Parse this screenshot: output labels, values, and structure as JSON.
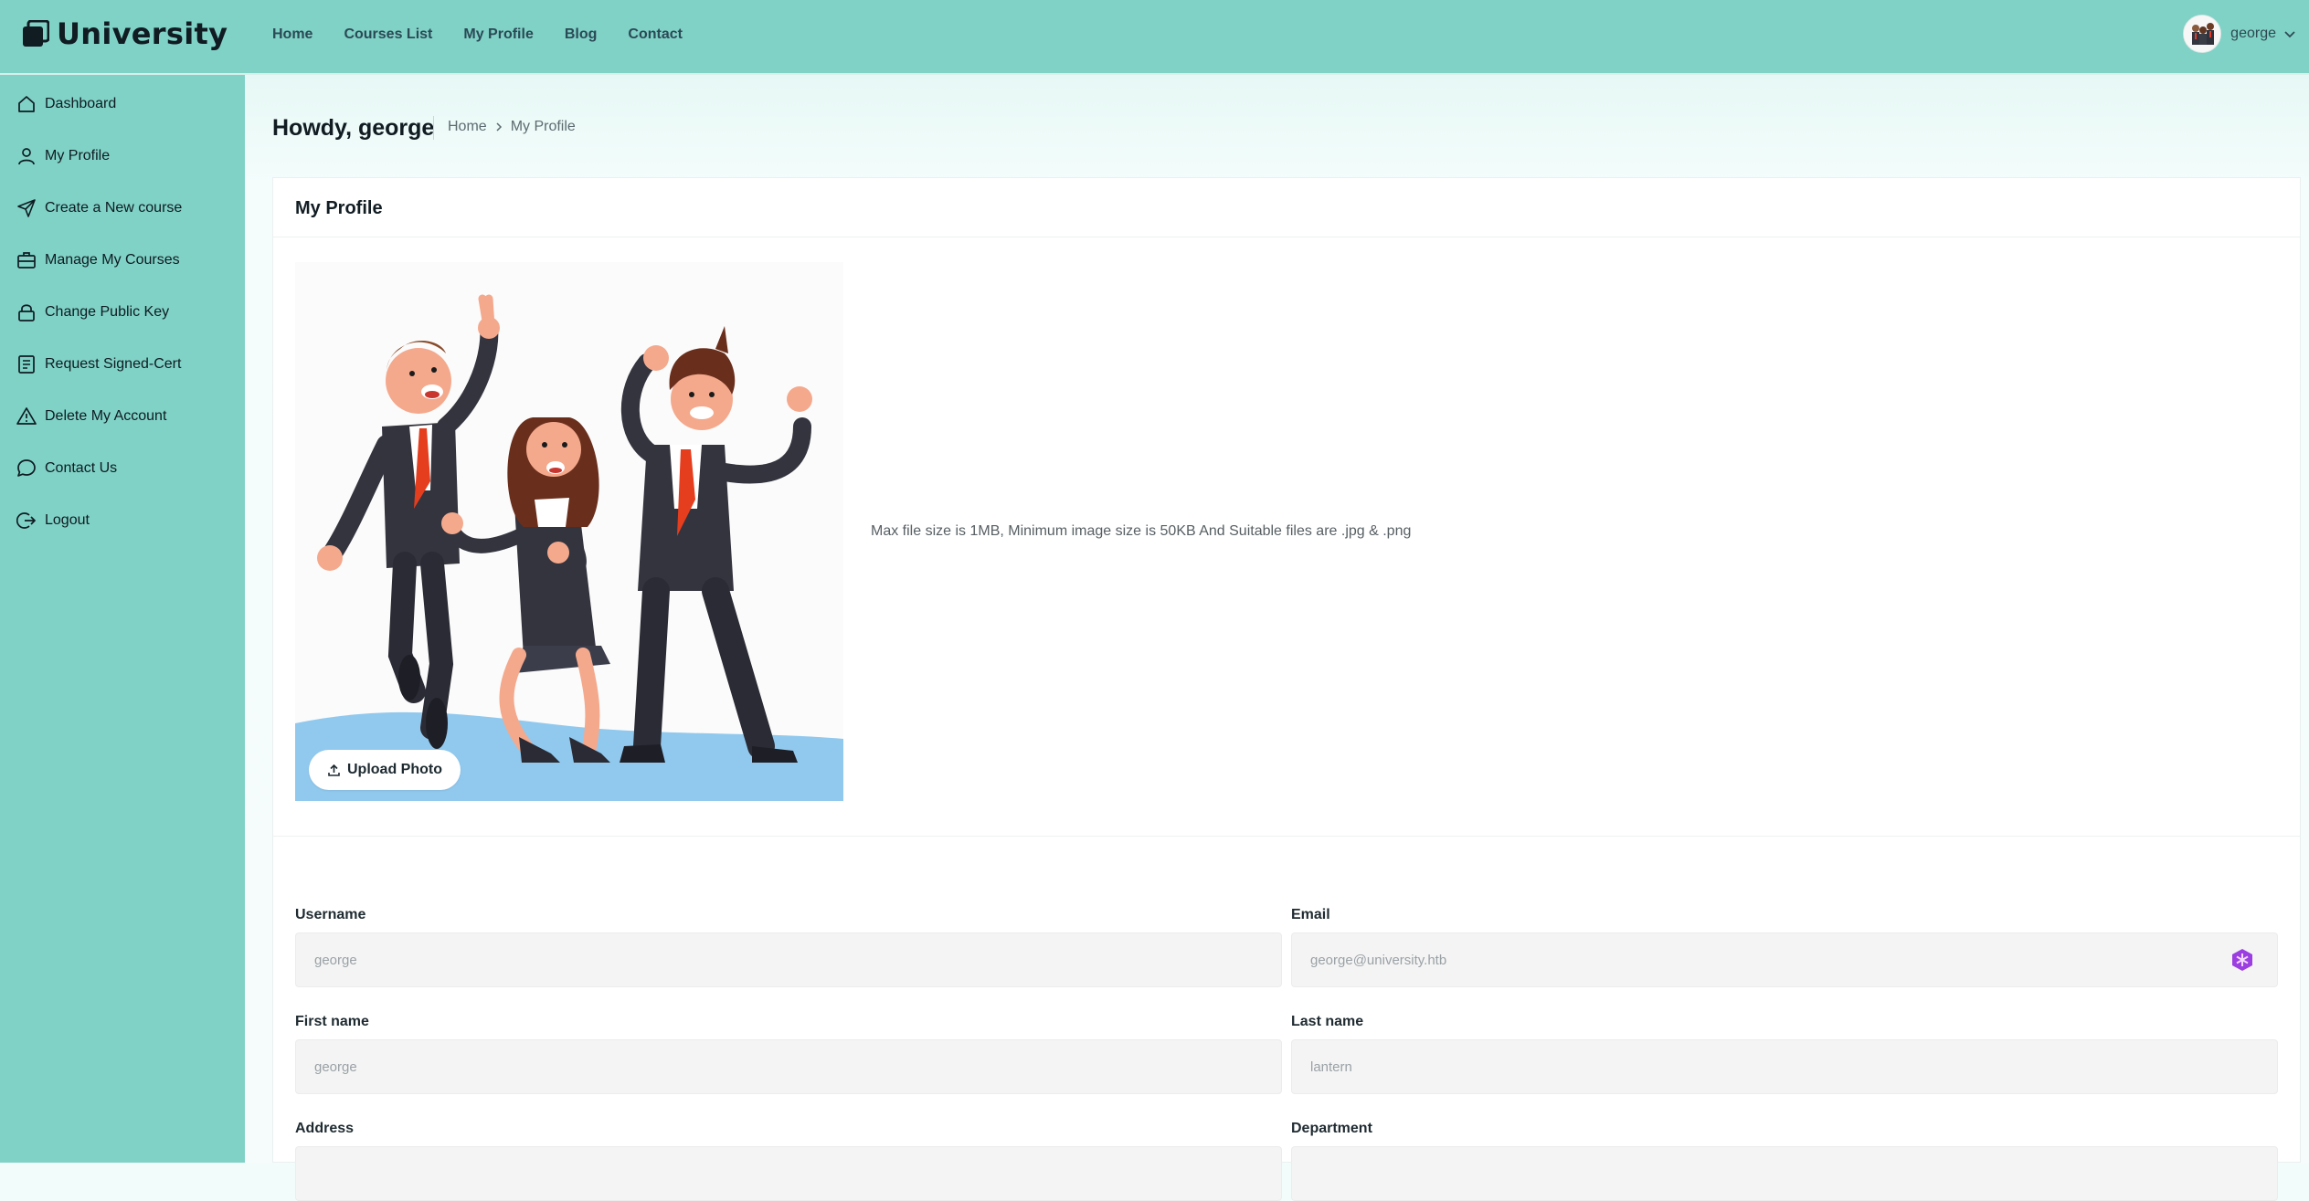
{
  "app": {
    "logo_text": "University",
    "nav": [
      "Home",
      "Courses List",
      "My Profile",
      "Blog",
      "Contact"
    ],
    "user_name": "george"
  },
  "sidebar": {
    "items": [
      {
        "label": "Dashboard",
        "icon": "home-icon"
      },
      {
        "label": "My Profile",
        "icon": "user-icon"
      },
      {
        "label": "Create a New course",
        "icon": "send-icon"
      },
      {
        "label": "Manage My Courses",
        "icon": "briefcase-icon"
      },
      {
        "label": "Change Public Key",
        "icon": "lock-icon"
      },
      {
        "label": "Request Signed-Cert",
        "icon": "document-icon"
      },
      {
        "label": "Delete My Account",
        "icon": "warning-icon"
      },
      {
        "label": "Contact Us",
        "icon": "chat-icon"
      },
      {
        "label": "Logout",
        "icon": "logout-icon"
      }
    ]
  },
  "page": {
    "greeting": "Howdy, george",
    "breadcrumb": [
      "Home",
      "My Profile"
    ]
  },
  "profile": {
    "card_title": "My Profile",
    "upload_label": "Upload Photo",
    "file_note": "Max file size is 1MB, Minimum image size is 50KB And Suitable files are .jpg & .png"
  },
  "form": {
    "username": {
      "label": "Username",
      "placeholder": "george"
    },
    "email": {
      "label": "Email",
      "placeholder": "george@university.htb"
    },
    "first_name": {
      "label": "First name",
      "placeholder": "george"
    },
    "last_name": {
      "label": "Last name",
      "placeholder": "lantern"
    },
    "address": {
      "label": "Address"
    },
    "department": {
      "label": "Department"
    }
  },
  "colors": {
    "header_bg": "#80d1c6",
    "sidebar_bg": "#80d1c6",
    "card_bg": "#ffffff",
    "input_bg": "#f4f4f4"
  }
}
